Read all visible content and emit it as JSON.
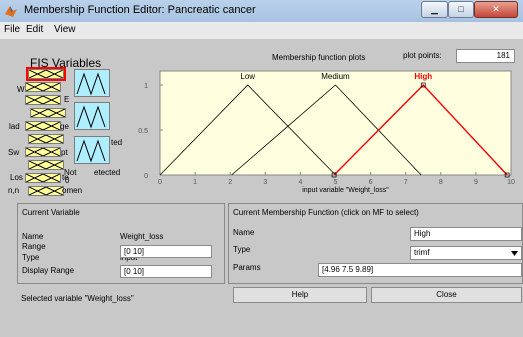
{
  "window": {
    "title": "Membership Function Editor: Pancreatic cancer",
    "icon": "matlab-icon",
    "min_glyph": "▁",
    "max_glyph": "□",
    "close_glyph": "✕"
  },
  "menu": [
    "File",
    "Edit",
    "View"
  ],
  "fis": {
    "title": "FIS Variables",
    "labels": [
      "W",
      "E",
      "lad",
      "ge",
      "Sw",
      "pt",
      "Los",
      "te",
      "n,n",
      "omen",
      "ted",
      "Not",
      "etected",
      "0"
    ]
  },
  "plot_header": {
    "title": "Membership function plots",
    "points_label": "plot points:",
    "points_value": "181"
  },
  "chart_data": {
    "type": "line",
    "title": "",
    "xlabel": "input variable \"Weight_loss\"",
    "ylabel": "",
    "xlim": [
      0,
      10
    ],
    "ylim": [
      0,
      1
    ],
    "x_ticks": [
      "0",
      "1",
      "2",
      "3",
      "4",
      "5",
      "6",
      "7",
      "8",
      "9",
      "10"
    ],
    "y_ticks": [
      "0",
      "0.5",
      "1"
    ],
    "series": [
      {
        "name": "Low",
        "x": [
          0,
          2.5,
          5
        ],
        "y": [
          0,
          1,
          0
        ],
        "color": "#000000",
        "selected": false
      },
      {
        "name": "Medium",
        "x": [
          2.04,
          5,
          7.44
        ],
        "y": [
          0,
          1,
          0
        ],
        "color": "#000000",
        "selected": false
      },
      {
        "name": "High",
        "x": [
          4.96,
          7.5,
          9.89
        ],
        "y": [
          0,
          1,
          0
        ],
        "color": "#ff0000",
        "selected": true
      }
    ]
  },
  "current_variable": {
    "title": "Current Variable",
    "name_label": "Name",
    "name_value": "Weight_loss",
    "type_label": "Type",
    "type_value": "input",
    "range_label": "Range",
    "range_value": "[0 10]",
    "display_range_label": "Display Range",
    "display_range_value": "[0 10]"
  },
  "current_mf": {
    "title": "Current Membership Function (click on MF to select)",
    "name_label": "Name",
    "name_value": "High",
    "type_label": "Type",
    "type_value": "trimf",
    "params_label": "Params",
    "params_value": "[4.96 7.5 9.89]",
    "help_label": "Help",
    "close_label": "Close"
  },
  "status": "Selected variable \"Weight_loss\"",
  "colors": {
    "plot_bg": "#ffffe0",
    "selected_mf": "#ff0000",
    "input_block": "#ffff99",
    "output_block": "#aeeefe"
  }
}
